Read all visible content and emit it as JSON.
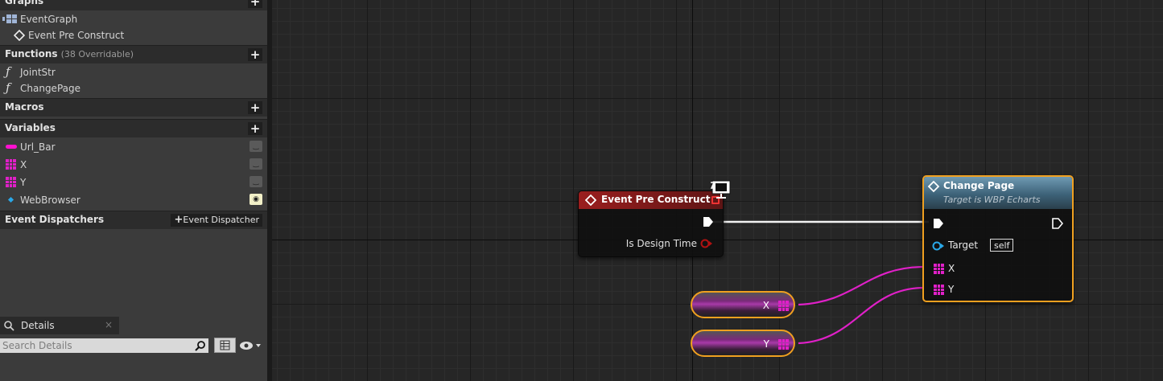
{
  "sections": {
    "graphs": {
      "title": "Graphs",
      "items": [
        "EventGraph",
        "Event Pre Construct"
      ]
    },
    "functions": {
      "title": "Functions",
      "subtitle": "(38 Overridable)",
      "items": [
        "JointStr",
        "ChangePage"
      ]
    },
    "macros": {
      "title": "Macros"
    },
    "variables": {
      "title": "Variables",
      "items": [
        "Url_Bar",
        "X",
        "Y",
        "WebBrowser"
      ]
    },
    "event_dispatchers": {
      "title": "Event Dispatchers",
      "button": "Event Dispatcher"
    }
  },
  "details": {
    "tab": "Details",
    "search_placeholder": "Search Details"
  },
  "nodes": {
    "event_pre_construct": {
      "title": "Event Pre Construct",
      "pin": "Is Design Time"
    },
    "change_page": {
      "title": "Change Page",
      "subtitle": "Target is WBP Echarts",
      "target_label": "Target",
      "target_value": "self",
      "x_pin": "X",
      "y_pin": "Y"
    },
    "var_x": {
      "label": "X"
    },
    "var_y": {
      "label": "Y"
    }
  },
  "colors": {
    "accent_orange": "#f0a020",
    "pin_magenta": "#e020c8",
    "event_red": "#8b1a1a",
    "function_blue": "#5a8aa8"
  },
  "icons": {
    "graph": "event-graph-icon",
    "event": "event-diamond-icon",
    "function": "function-icon",
    "search": "search-icon",
    "eye": "eye-icon"
  }
}
